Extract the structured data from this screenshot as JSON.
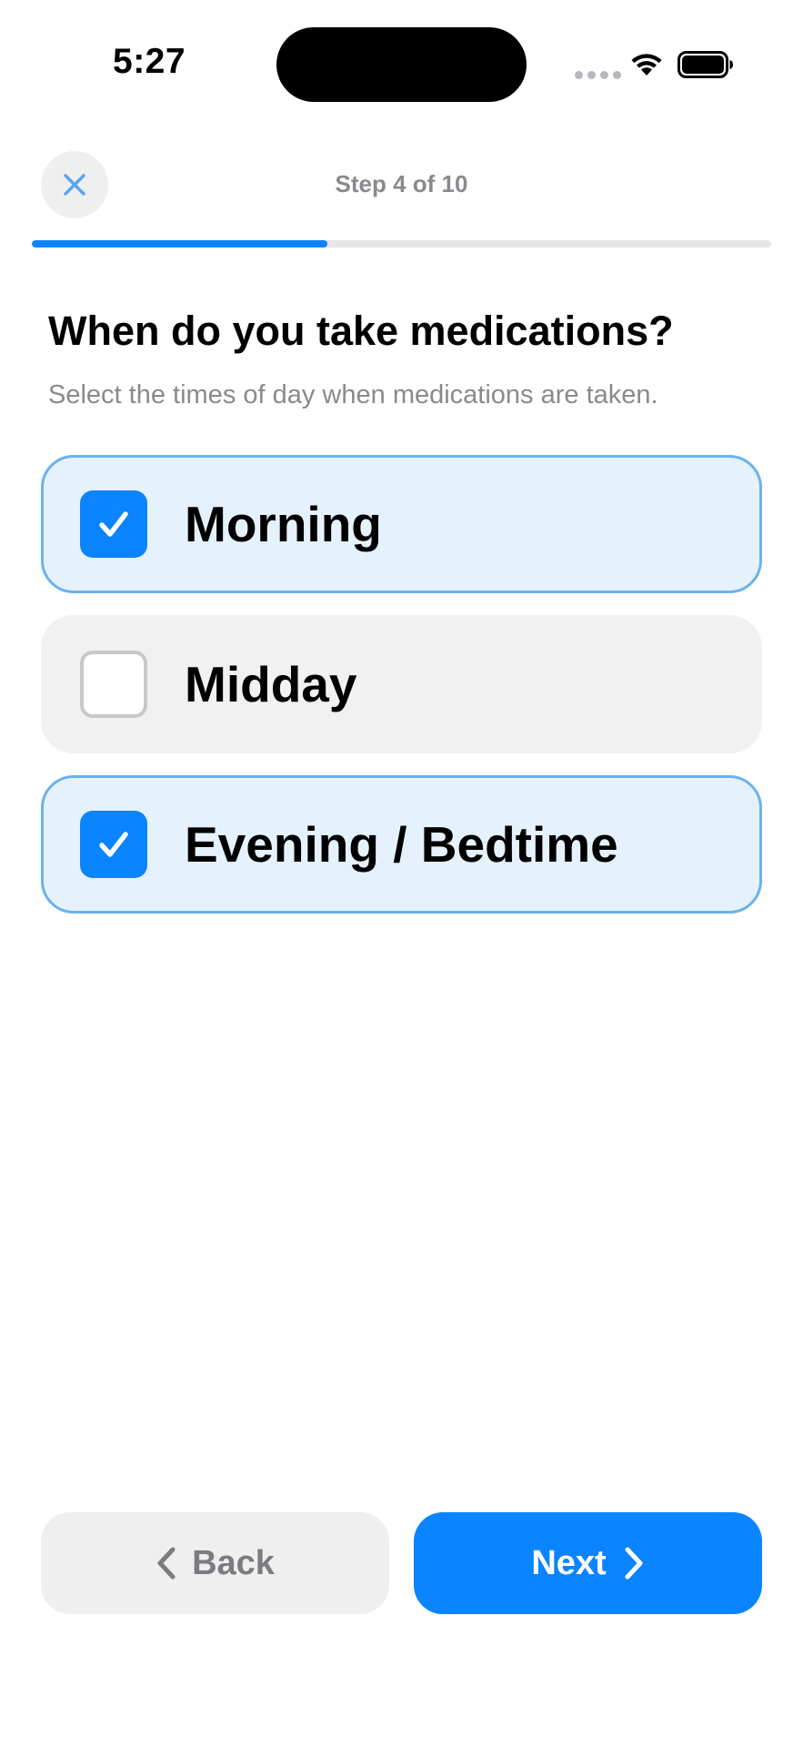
{
  "status_bar": {
    "time": "5:27"
  },
  "header": {
    "step_label": "Step 4 of 10",
    "progress_fraction": 0.4,
    "close_icon": "close-icon"
  },
  "question": {
    "title": "When do you take medications?",
    "subtitle": "Select the times of day when medications are taken."
  },
  "options": [
    {
      "label": "Morning",
      "selected": true
    },
    {
      "label": "Midday",
      "selected": false
    },
    {
      "label": "Evening / Bedtime",
      "selected": true
    }
  ],
  "footer": {
    "back_label": "Back",
    "next_label": "Next"
  },
  "colors": {
    "accent": "#0a84ff",
    "selected_bg": "#e5f2fe",
    "selected_border": "#6ab2ee",
    "unselected_bg": "#f1f1f2"
  }
}
